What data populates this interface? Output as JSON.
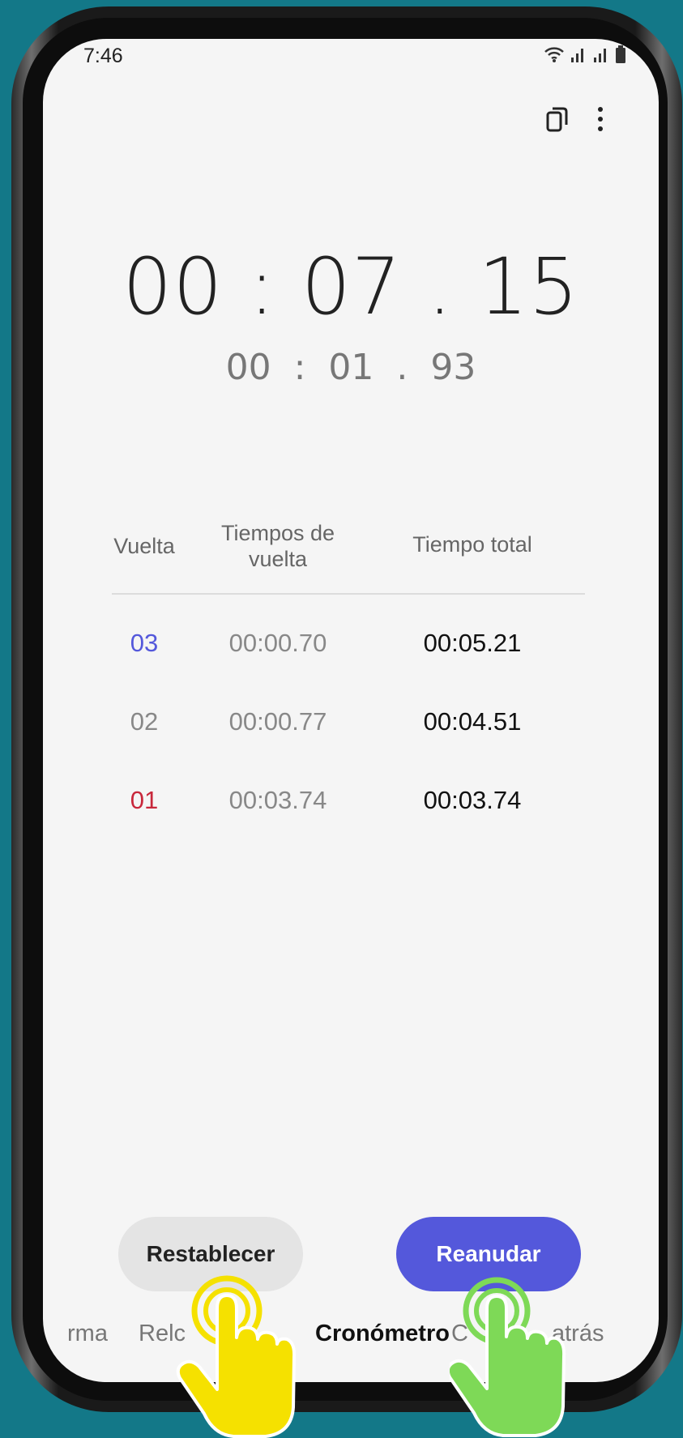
{
  "status_bar": {
    "time": "7:46"
  },
  "toolbar": {
    "multiwindow_icon": "multiwindow-icon",
    "more_icon": "more-vertical-icon"
  },
  "stopwatch": {
    "total_time": "00 : 07 . 15",
    "lap_time": "00  :  01  .  93"
  },
  "laps_table": {
    "headers": {
      "lap": "Vuelta",
      "lap_time_line1": "Tiempos de",
      "lap_time_line2": "vuelta",
      "total": "Tiempo total"
    },
    "rows": [
      {
        "lap": "03",
        "lap_time": "00:00.70",
        "total": "00:05.21",
        "color": "#5458db"
      },
      {
        "lap": "02",
        "lap_time": "00:00.77",
        "total": "00:04.51",
        "color": "#888888"
      },
      {
        "lap": "01",
        "lap_time": "00:03.74",
        "total": "00:03.74",
        "color": "#c8283c"
      }
    ]
  },
  "buttons": {
    "reset": "Restablecer",
    "resume": "Reanudar"
  },
  "tabs": [
    "rma",
    "Relc",
    "Cronómetro",
    "C",
    "atrás"
  ],
  "colors": {
    "background": "#137888",
    "accent": "#5458db",
    "hand_yellow": "#f5e100",
    "hand_green": "#7ed957"
  }
}
